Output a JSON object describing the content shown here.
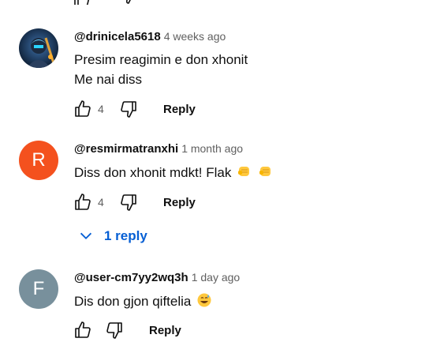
{
  "comments": [
    {
      "author": "@drinicela5618",
      "time": "4 weeks ago",
      "lines": [
        "Presim reagimin e don xhonit",
        "Me nai diss"
      ],
      "likes": "4",
      "reply_label": "Reply",
      "avatar": {
        "type": "image",
        "icon": "profile-image"
      }
    },
    {
      "author": "@resmirmatranxhi",
      "time": "1 month ago",
      "lines": [
        "Diss don xhonit mdkt! Flak"
      ],
      "emojis": [
        "oncoming-fist",
        "oncoming-fist"
      ],
      "likes": "4",
      "reply_label": "Reply",
      "avatar": {
        "type": "letter",
        "letter": "R",
        "color": "#f4511e"
      },
      "replies_label": "1 reply"
    },
    {
      "author": "@user-cm7yy2wq3h",
      "time": "1 day ago",
      "lines": [
        "Dis don gjon qiftelia"
      ],
      "emojis": [
        "grinning-face-with-sweat"
      ],
      "reply_label": "Reply",
      "avatar": {
        "type": "letter",
        "letter": "F",
        "color": "#78909c"
      }
    }
  ],
  "colors": {
    "link": "#065fd4",
    "secondary_text": "#606060"
  }
}
